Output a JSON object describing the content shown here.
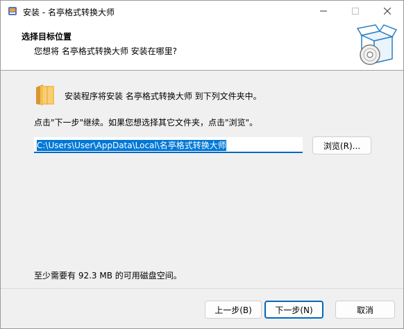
{
  "window": {
    "title": "安装 - 名亭格式转换大师"
  },
  "header": {
    "title": "选择目标位置",
    "subtitle": "您想将 名亭格式转换大师 安装在哪里?"
  },
  "body": {
    "intro": "安装程序将安装 名亭格式转换大师 到下列文件夹中。",
    "instruction": "点击\"下一步\"继续。如果您想选择其它文件夹，点击\"浏览\"。",
    "install_path": "C:\\Users\\User\\AppData\\Local\\名亭格式转换大师",
    "browse_label": "浏览(R)...",
    "space_required": "至少需要有 92.3 MB 的可用磁盘空间。"
  },
  "footer": {
    "back_label": "上一步(B)",
    "next_label": "下一步(N)",
    "cancel_label": "取消"
  },
  "colors": {
    "accent": "#0067c0",
    "selection": "#0078d7",
    "folder": "#f0b040"
  }
}
